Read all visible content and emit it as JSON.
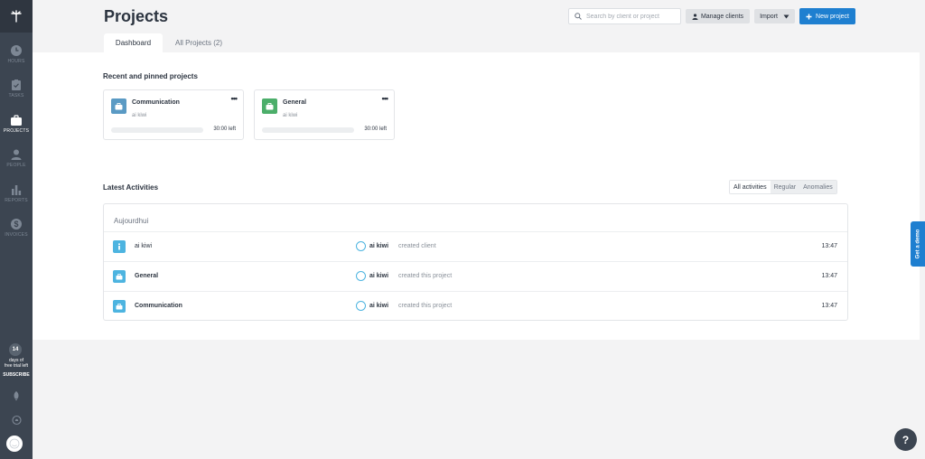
{
  "sidebar": {
    "items": [
      {
        "label": "HOURS",
        "icon": "clock-icon"
      },
      {
        "label": "TASKS",
        "icon": "clipboard-icon"
      },
      {
        "label": "PROJECTS",
        "icon": "briefcase-icon"
      },
      {
        "label": "PEOPLE",
        "icon": "person-icon"
      },
      {
        "label": "REPORTS",
        "icon": "bar-chart-icon"
      },
      {
        "label": "INVOICES",
        "icon": "dollar-icon"
      }
    ],
    "trial_days": "14",
    "trial_text_line1": "days of",
    "trial_text_line2": "free trial left",
    "subscribe_label": "SUBSCRIBE"
  },
  "header": {
    "title": "Projects",
    "search_placeholder": "Search by client or project",
    "manage_clients_label": "Manage clients",
    "import_label": "Import",
    "new_project_label": "New project"
  },
  "tabs": [
    {
      "label": "Dashboard",
      "active": true
    },
    {
      "label": "All Projects (2)",
      "active": false
    }
  ],
  "recent": {
    "title": "Recent and pinned projects",
    "projects": [
      {
        "name": "Communication",
        "client": "ai kiwi",
        "time_left": "30:00 left",
        "color": "#5a9ac4",
        "progress": 0
      },
      {
        "name": "General",
        "client": "ai kiwi",
        "time_left": "30:00 left",
        "color": "#4cae6a",
        "progress": 0
      }
    ]
  },
  "activities": {
    "title": "Latest Activities",
    "filters": [
      {
        "label": "All activities",
        "active": true
      },
      {
        "label": "Regular",
        "active": false
      },
      {
        "label": "Anomalies",
        "active": false
      }
    ],
    "day_label": "Aujourdhui",
    "rows": [
      {
        "name": "ai kiwi",
        "icon": "info-icon",
        "user": "ai kiwi",
        "action": "created client",
        "time": "13:47"
      },
      {
        "name": "General",
        "icon": "briefcase-icon",
        "user": "ai kiwi",
        "action": "created this project",
        "time": "13:47"
      },
      {
        "name": "Communication",
        "icon": "briefcase-icon",
        "user": "ai kiwi",
        "action": "created this project",
        "time": "13:47"
      }
    ]
  },
  "demo_label": "Get a demo",
  "help_label": "?"
}
